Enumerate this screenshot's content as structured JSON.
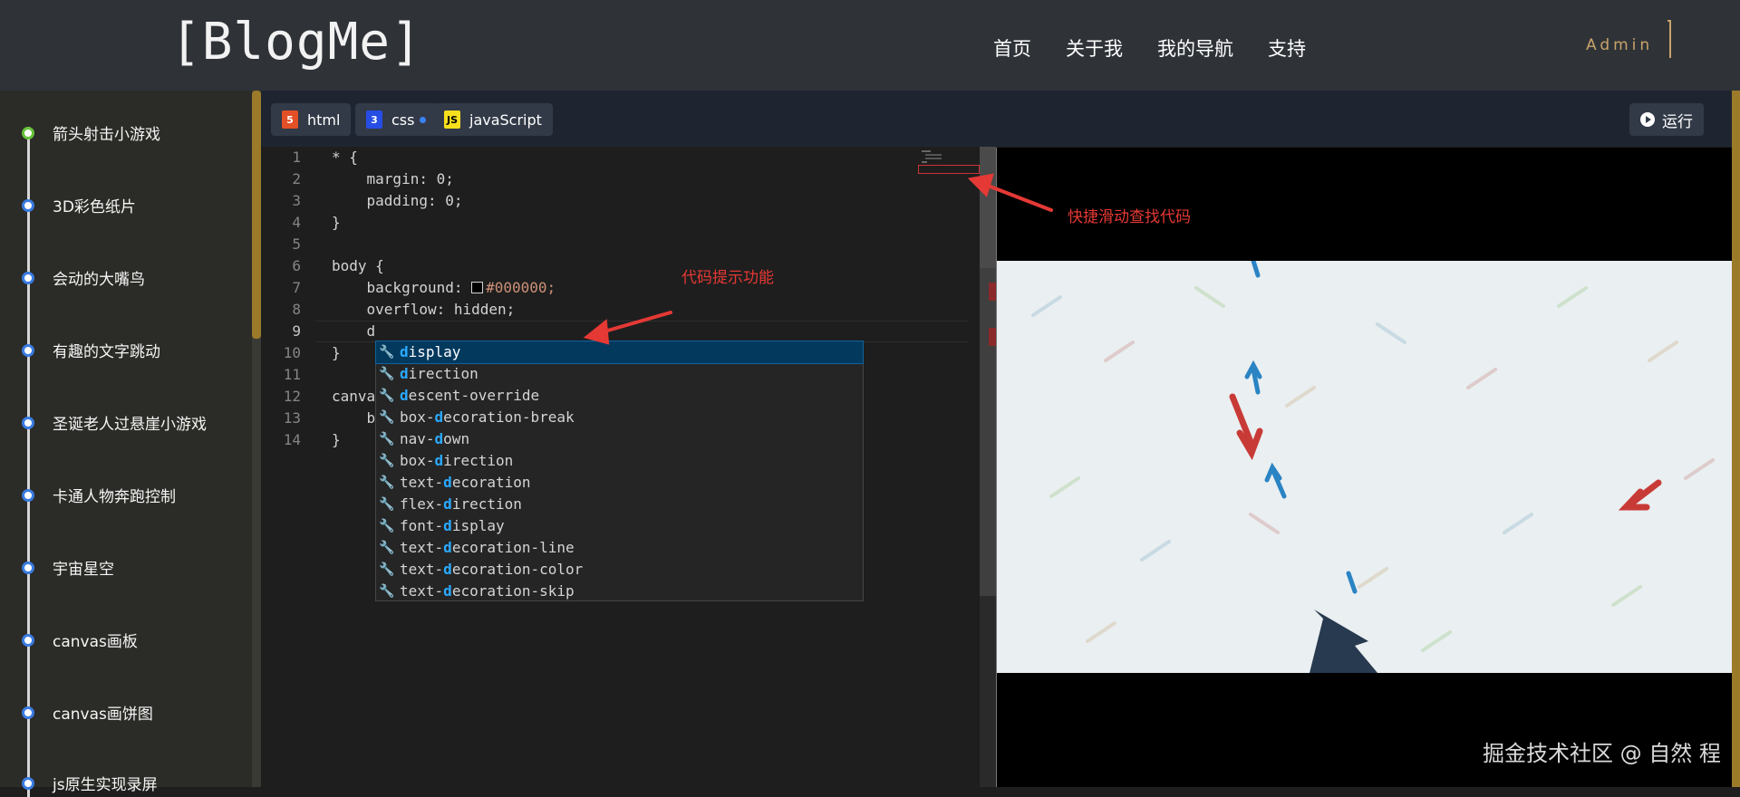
{
  "header": {
    "logo": "[BlogMe]",
    "nav": [
      "首页",
      "关于我",
      "我的导航",
      "支持"
    ],
    "user": "Admin"
  },
  "sidebar": {
    "items": [
      {
        "label": "箭头射击小游戏",
        "active": true
      },
      {
        "label": "3D彩色纸片",
        "active": false
      },
      {
        "label": "会动的大嘴鸟",
        "active": false
      },
      {
        "label": "有趣的文字跳动",
        "active": false
      },
      {
        "label": "圣诞老人过悬崖小游戏",
        "active": false
      },
      {
        "label": "卡通人物奔跑控制",
        "active": false
      },
      {
        "label": "宇宙星空",
        "active": false
      },
      {
        "label": "canvas画板",
        "active": false
      },
      {
        "label": "canvas画饼图",
        "active": false
      },
      {
        "label": "js原生实现录屏",
        "active": false
      }
    ]
  },
  "editor": {
    "tabs": [
      {
        "label": "html",
        "icon": "html5-icon",
        "modified": false
      },
      {
        "label": "css",
        "icon": "css3-icon",
        "modified": true
      },
      {
        "label": "javaScript",
        "icon": "js-icon",
        "modified": false
      }
    ],
    "run_label": "运行",
    "line_numbers": [
      "1",
      "2",
      "3",
      "4",
      "5",
      "6",
      "7",
      "8",
      "9",
      "10",
      "11",
      "12",
      "13",
      "14"
    ],
    "code": [
      "* {",
      "    margin: 0;",
      "    padding: 0;",
      "}",
      "",
      "body {",
      "    background: #000000;",
      "    overflow: hidden;",
      "    d",
      "}",
      "",
      "canva",
      "    b",
      "}"
    ],
    "suggestions": [
      {
        "pre": "",
        "match": "d",
        "post": "isplay"
      },
      {
        "pre": "",
        "match": "d",
        "post": "irection"
      },
      {
        "pre": "",
        "match": "d",
        "post": "escent-override"
      },
      {
        "pre": "box-",
        "match": "d",
        "post": "ecoration-break"
      },
      {
        "pre": "nav-",
        "match": "d",
        "post": "own"
      },
      {
        "pre": "box-",
        "match": "d",
        "post": "irection"
      },
      {
        "pre": "text-",
        "match": "d",
        "post": "ecoration"
      },
      {
        "pre": "flex-",
        "match": "d",
        "post": "irection"
      },
      {
        "pre": "font-",
        "match": "d",
        "post": "isplay"
      },
      {
        "pre": "text-",
        "match": "d",
        "post": "ecoration-line"
      },
      {
        "pre": "text-",
        "match": "d",
        "post": "ecoration-color"
      },
      {
        "pre": "text-",
        "match": "d",
        "post": "ecoration-skip"
      }
    ]
  },
  "annotations": {
    "code_hint": "代码提示功能",
    "minimap_hint": "快捷滑动查找代码"
  },
  "watermark": "掘金技术社区 @ 自然 程",
  "colors": {
    "accent": "#c9a36a",
    "annotation": "#e53935",
    "suggestion_match": "#2aaaff"
  }
}
